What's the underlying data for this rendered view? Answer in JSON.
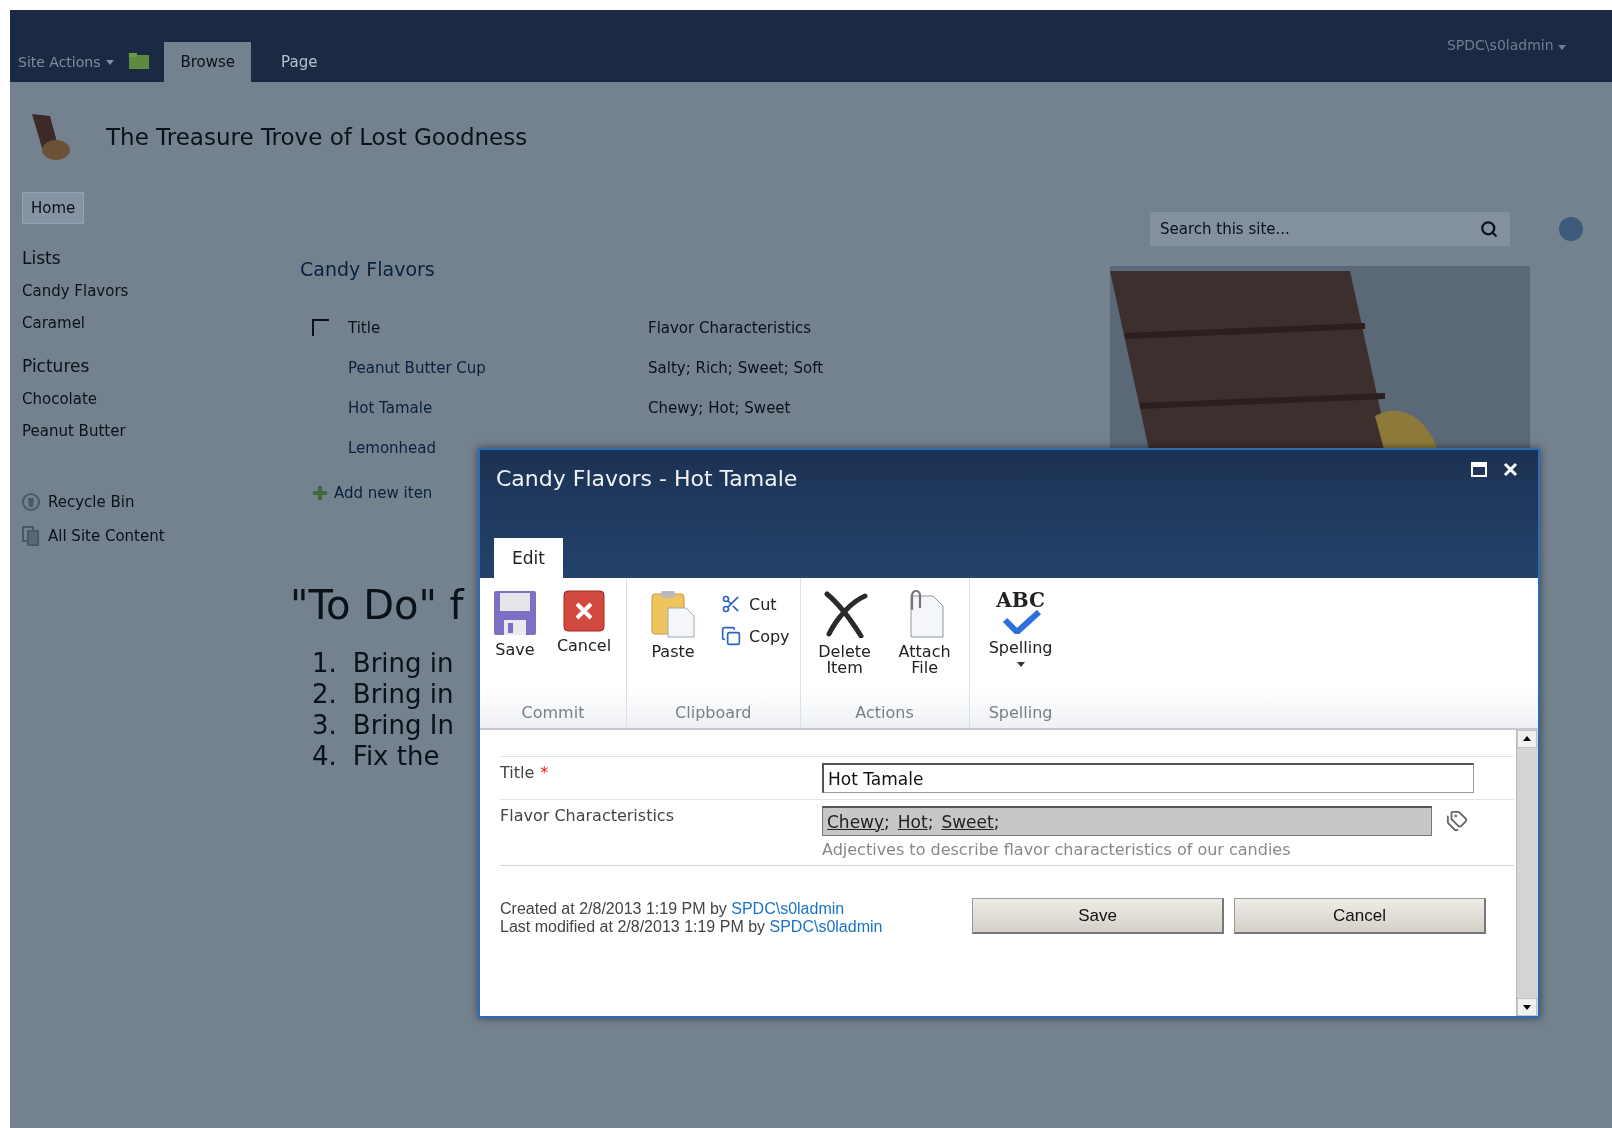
{
  "top_bar": {
    "site_actions": "Site Actions",
    "tabs": [
      {
        "label": "Browse",
        "selected": true
      },
      {
        "label": "Page",
        "selected": false
      }
    ],
    "user": "SPDC\\s0ladmin"
  },
  "site": {
    "title": "The Treasure Trove of Lost Goodness"
  },
  "search": {
    "placeholder": "Search this site..."
  },
  "quick_launch": {
    "home": {
      "label": "Home",
      "selected": true
    },
    "sections": [
      {
        "heading": "Lists",
        "items": [
          {
            "label": "Candy Flavors",
            "selected": false
          },
          {
            "label": "Caramel",
            "selected": false
          }
        ]
      },
      {
        "heading": "Pictures",
        "items": [
          {
            "label": "Chocolate",
            "selected": false
          },
          {
            "label": "Peanut Butter",
            "selected": false
          }
        ]
      }
    ],
    "links": [
      "Recycle Bin",
      "All Site Content"
    ]
  },
  "list_view": {
    "title": "Candy Flavors",
    "select_all": {
      "checked": false
    },
    "columns": [
      "Title",
      "Flavor Characteristics"
    ],
    "rows": [
      {
        "title": "Peanut Butter Cup",
        "flavor": "Salty; Rich; Sweet; Soft"
      },
      {
        "title": "Hot Tamale",
        "flavor": "Chewy; Hot; Sweet"
      },
      {
        "title": "Lemonhead"
      }
    ],
    "add_link": "Add new iten"
  },
  "todo": {
    "heading": "\"To Do\" f",
    "items": [
      {
        "number": "1.",
        "text": "Bring in"
      },
      {
        "number": "2.",
        "text": "Bring in"
      },
      {
        "number": "3.",
        "text": "Bring In"
      },
      {
        "number": "4.",
        "text": "Fix the"
      }
    ]
  },
  "dialog": {
    "title": "Candy Flavors - Hot Tamale",
    "ribbon": {
      "tabs": [
        {
          "label": "Edit",
          "selected": true
        }
      ],
      "groups": [
        {
          "label": "Commit",
          "buttons": [
            {
              "label": "Save",
              "kind": "large"
            },
            {
              "label": "Cancel",
              "kind": "large"
            }
          ]
        },
        {
          "label": "Clipboard",
          "buttons": [
            {
              "label": "Paste",
              "kind": "large"
            },
            {
              "label": "Cut",
              "kind": "small"
            },
            {
              "label": "Copy",
              "kind": "small"
            }
          ]
        },
        {
          "label": "Actions",
          "buttons": [
            {
              "label": "Delete Item",
              "kind": "large"
            },
            {
              "label": "Attach File",
              "kind": "large"
            }
          ]
        },
        {
          "label": "Spelling",
          "buttons": [
            {
              "label": "Spelling",
              "kind": "large",
              "glyph": "ABC",
              "dropdown": true
            }
          ]
        }
      ]
    },
    "fields": [
      {
        "label": "Title",
        "required_mark": "*",
        "kind": "text",
        "value": "Hot Tamale"
      },
      {
        "label": "Flavor Characteristics",
        "kind": "terms",
        "terms": [
          "Chewy",
          "Hot",
          "Sweet"
        ],
        "separator": ";",
        "description": "Adjectives to describe flavor characteristics of our candies"
      }
    ],
    "created": {
      "text": "Created at 2/8/2013 1:19 PM by",
      "user": "SPDC\\s0ladmin"
    },
    "modified": {
      "text": "Last modified at 2/8/2013 1:19 PM by",
      "user": "SPDC\\s0ladmin"
    },
    "buttons": [
      "Save",
      "Cancel"
    ]
  }
}
